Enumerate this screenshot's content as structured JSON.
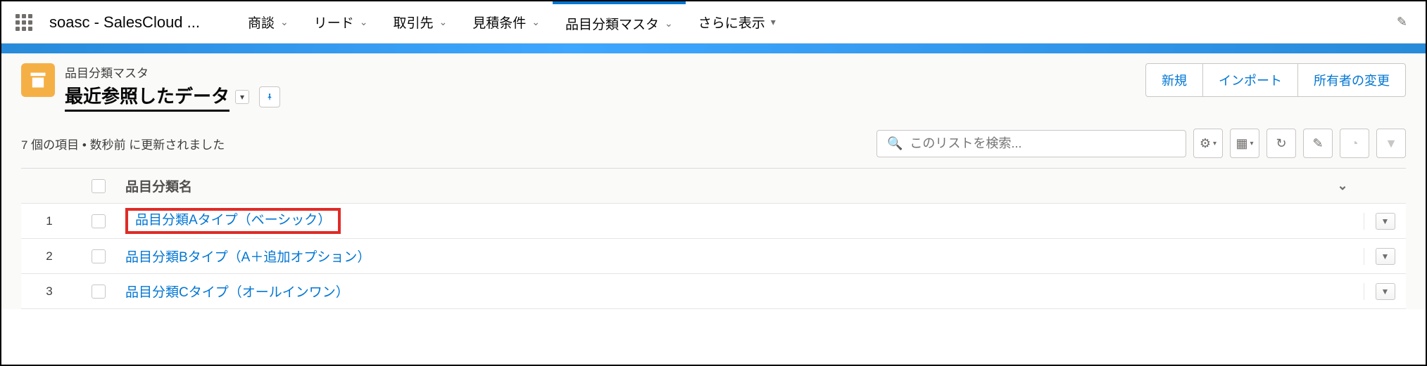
{
  "topbar": {
    "app_name": "soasc - SalesCloud ...",
    "nav": [
      {
        "label": "商談",
        "active": false
      },
      {
        "label": "リード",
        "active": false
      },
      {
        "label": "取引先",
        "active": false
      },
      {
        "label": "見積条件",
        "active": false
      },
      {
        "label": "品目分類マスタ",
        "active": true
      },
      {
        "label": "さらに表示",
        "active": false
      }
    ]
  },
  "header": {
    "object_type": "品目分類マスタ",
    "list_title": "最近参照したデータ",
    "actions": {
      "new": "新規",
      "import": "インポート",
      "change_owner": "所有者の変更"
    }
  },
  "status_text": "7 個の項目 • 数秒前 に更新されました",
  "search": {
    "placeholder": "このリストを検索..."
  },
  "table": {
    "column_header": "品目分類名",
    "rows": [
      {
        "num": "1",
        "name": "品目分類Aタイプ（ベーシック）",
        "highlighted": true
      },
      {
        "num": "2",
        "name": "品目分類Bタイプ（A＋追加オプション）",
        "highlighted": false
      },
      {
        "num": "3",
        "name": "品目分類Cタイプ（オールインワン）",
        "highlighted": false
      }
    ]
  }
}
